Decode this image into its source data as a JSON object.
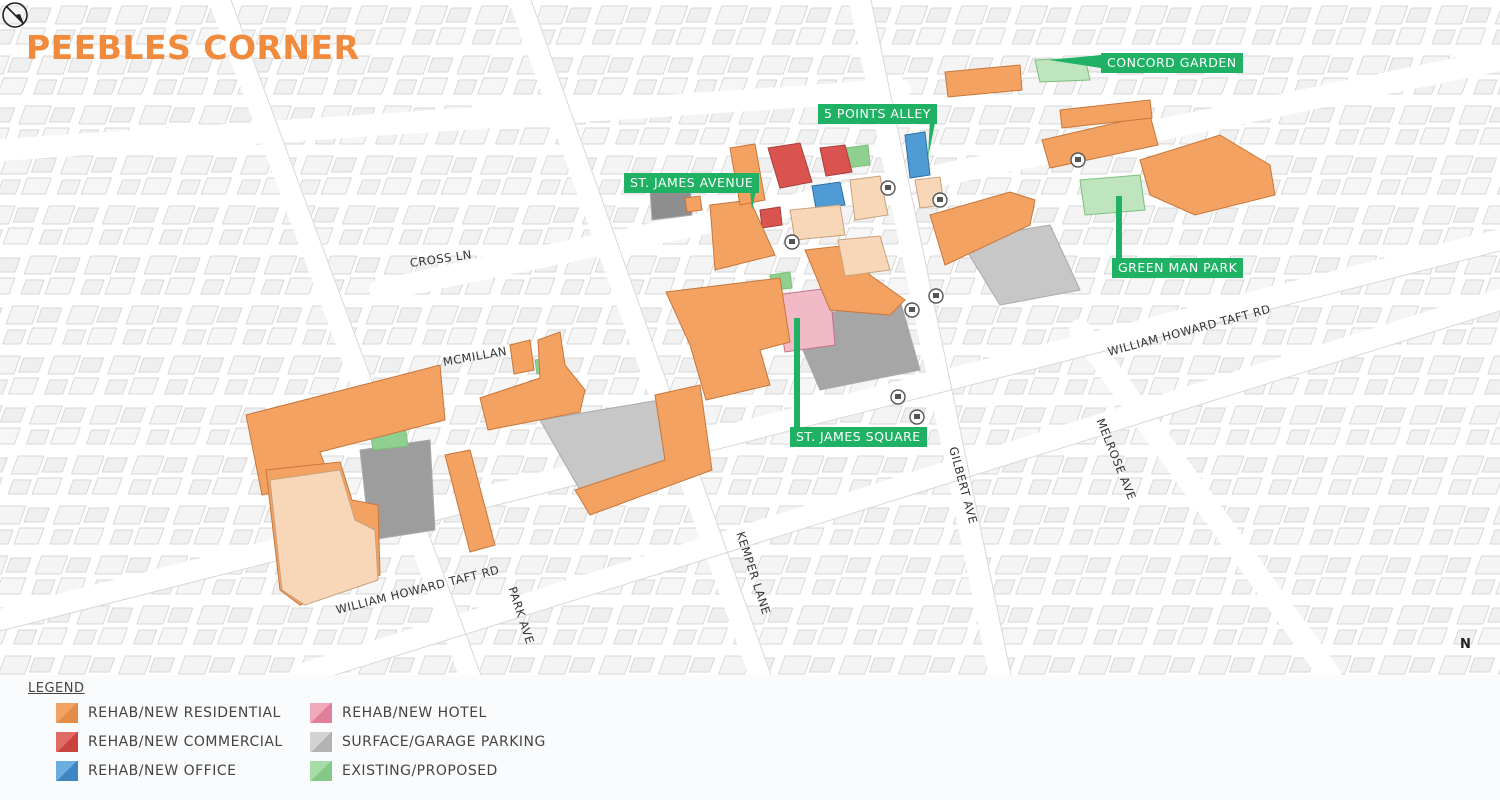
{
  "map": {
    "title": "PEEBLES CORNER",
    "callouts": {
      "concord_garden": "CONCORD GARDEN",
      "five_points_alley": "5 POINTS ALLEY",
      "st_james_avenue": "ST. JAMES AVENUE",
      "green_man_park": "GREEN MAN PARK",
      "st_james_square": "ST. JAMES SQUARE"
    },
    "roads": {
      "cross_ln": "CROSS LN",
      "mcmillan": "MCMILLAN",
      "william_howard_taft_rd_east": "WILLIAM HOWARD TAFT RD",
      "william_howard_taft_rd_west": "WILLIAM HOWARD TAFT RD",
      "melrose_ave": "MELROSE AVE",
      "gilbert_ave": "GILBERT AVE",
      "kemper_lane": "KEMPER LANE",
      "park_ave": "PARK AVE"
    },
    "north_label": "N",
    "colors": {
      "residential": "#f3a262",
      "commercial": "#d9534f",
      "office": "#4f9bd6",
      "hotel": "#e98fa6",
      "parking": "#c7c7c7",
      "green": "#8fcf8f",
      "callout": "#1fb265"
    }
  },
  "legend": {
    "title": "LEGEND",
    "items": [
      {
        "label": "REHAB/NEW RESIDENTIAL",
        "color": "#f3a262"
      },
      {
        "label": "REHAB/NEW COMMERCIAL",
        "color": "#d9534f"
      },
      {
        "label": "REHAB/NEW OFFICE",
        "color": "#4f9bd6"
      },
      {
        "label": "REHAB/NEW HOTEL",
        "color": "#e98fa6"
      },
      {
        "label": "SURFACE/GARAGE PARKING",
        "color": "#c7c7c7"
      },
      {
        "label": "EXISTING/PROPOSED",
        "color": "#8fcf8f"
      }
    ]
  }
}
